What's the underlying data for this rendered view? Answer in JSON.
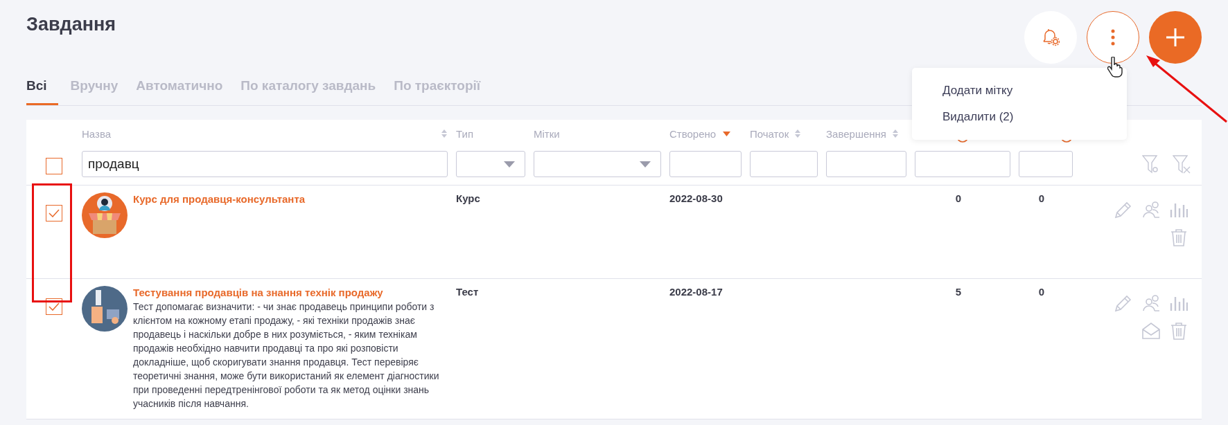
{
  "page": {
    "title": "Завдання"
  },
  "header_buttons": [
    {
      "kind": "bell",
      "selected": false
    },
    {
      "kind": "more",
      "selected": true
    },
    {
      "kind": "add",
      "selected": false
    }
  ],
  "menu": {
    "items": [
      "Додати мітку",
      "Видалити (2)"
    ]
  },
  "tabs": [
    {
      "label": "Всі",
      "selected": true
    },
    {
      "label": "Вручну",
      "selected": false
    },
    {
      "label": "Автоматично",
      "selected": false
    },
    {
      "label": "По каталогу завдань",
      "selected": false
    },
    {
      "label": "По траєкторії",
      "selected": false
    }
  ],
  "table": {
    "select_all": {
      "checked": false
    },
    "columns": [
      {
        "label": "Назва",
        "kind": "sortable"
      },
      {
        "label": "Тип",
        "kind": "plain"
      },
      {
        "label": "Мітки",
        "kind": "plain"
      },
      {
        "label": "Створено",
        "kind": "sorted"
      },
      {
        "label": "Початок",
        "kind": "sortable"
      },
      {
        "label": "Завершення",
        "kind": "sortable"
      },
      {
        "kind": "info"
      },
      {
        "kind": "info"
      }
    ],
    "filters": [
      {
        "kind": "text",
        "value": "продавц"
      },
      {
        "kind": "select"
      },
      {
        "kind": "select"
      },
      {
        "kind": "text"
      },
      {
        "kind": "text"
      },
      {
        "kind": "text"
      },
      {
        "kind": "text"
      },
      {
        "kind": "text"
      }
    ],
    "rows": [
      {
        "checked": true,
        "title": "Курс для продавця-консультанта",
        "type": "Курс",
        "created": "2022-08-30",
        "column_7": "0",
        "column_8": "0",
        "actions": [
          {
            "kind": "edit"
          },
          {
            "kind": "users"
          },
          {
            "kind": "stats"
          },
          {
            "kind": "delete"
          }
        ]
      },
      {
        "checked": true,
        "title": "Тестування продавців на знання технік продажу",
        "description": "Тест допомагає визначити: - чи знає продавець принципи роботи з клієнтом на кожному етапі продажу, - які техніки продажів знає продавець і наскільки добре в них розуміється, - яким технікам продажів необхідно навчити продавці та про які розповісти докладніше, щоб скоригувати знання продавця. Тест перевіряє теоретичні знання, може бути використаний як елемент діагностики при проведенні передтренінгової роботи та як метод оцінки знань учасників після навчання.",
        "type": "Тест",
        "created": "2022-08-17",
        "column_7": "5",
        "column_8": "0",
        "actions": [
          {
            "kind": "edit"
          },
          {
            "kind": "users"
          },
          {
            "kind": "stats"
          },
          {
            "kind": "mail"
          },
          {
            "kind": "delete"
          }
        ]
      }
    ]
  }
}
